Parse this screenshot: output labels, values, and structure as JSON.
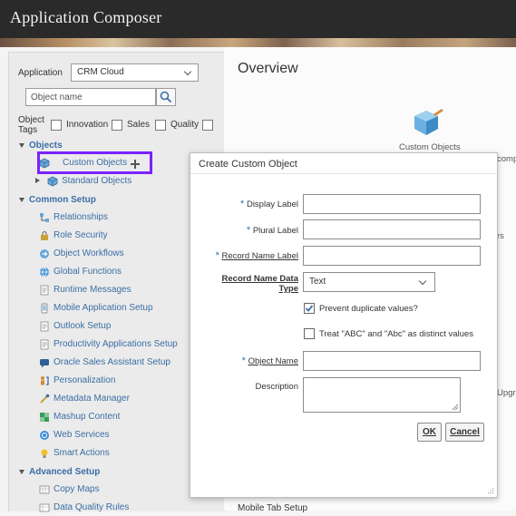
{
  "app": {
    "title": "Application Composer"
  },
  "left": {
    "application_label": "Application",
    "application_value": "CRM Cloud",
    "search_placeholder": "Object name",
    "object_tags_label": "Object Tags",
    "tags": [
      "Innovation",
      "Sales",
      "Quality"
    ],
    "objects_section": "Objects",
    "objects_items": [
      {
        "label": "Custom Objects",
        "icon": "cube-icon"
      },
      {
        "label": "Standard Objects",
        "icon": "cube-icon"
      }
    ],
    "common_setup_section": "Common Setup",
    "common_setup_items": [
      {
        "label": "Relationships",
        "icon": "relationships-icon"
      },
      {
        "label": "Role Security",
        "icon": "lock-icon"
      },
      {
        "label": "Object Workflows",
        "icon": "workflow-icon"
      },
      {
        "label": "Global Functions",
        "icon": "globe-icon"
      },
      {
        "label": "Runtime Messages",
        "icon": "document-icon"
      },
      {
        "label": "Mobile Application Setup",
        "icon": "mobile-icon"
      },
      {
        "label": "Outlook Setup",
        "icon": "document-icon"
      },
      {
        "label": "Productivity Applications Setup",
        "icon": "document-icon"
      },
      {
        "label": "Oracle Sales Assistant Setup",
        "icon": "assistant-icon"
      },
      {
        "label": "Personalization",
        "icon": "personalization-icon"
      },
      {
        "label": "Metadata Manager",
        "icon": "metadata-icon"
      },
      {
        "label": "Mashup Content",
        "icon": "mashup-icon"
      },
      {
        "label": "Web Services",
        "icon": "web-services-icon"
      },
      {
        "label": "Smart Actions",
        "icon": "lightbulb-icon"
      }
    ],
    "advanced_setup_section": "Advanced Setup",
    "advanced_setup_items": [
      {
        "label": "Copy Maps",
        "icon": "copy-maps-icon"
      },
      {
        "label": "Data Quality Rules",
        "icon": "data-quality-icon"
      }
    ]
  },
  "main": {
    "overview_title": "Overview",
    "custom_objects_caption": "Custom Objects",
    "bg_fragments": [
      "comp",
      "rs",
      "Upgra"
    ],
    "bottom_fragment": "Mobile Tab Setup"
  },
  "dialog": {
    "title": "Create Custom Object",
    "display_label": "Display Label",
    "plural_label": "Plural Label",
    "record_name_label": "Record Name Label",
    "record_name_data_type_label": "Record Name Data Type",
    "record_name_data_type_value": "Text",
    "prevent_duplicates_label": "Prevent duplicate values?",
    "prevent_duplicates_checked": true,
    "treat_distinct_label": "Treat \"ABC\" and \"Abc\" as distinct values",
    "treat_distinct_checked": false,
    "object_name_label": "Object Name",
    "description_label": "Description",
    "ok_label": "OK",
    "cancel_label": "Cancel"
  }
}
